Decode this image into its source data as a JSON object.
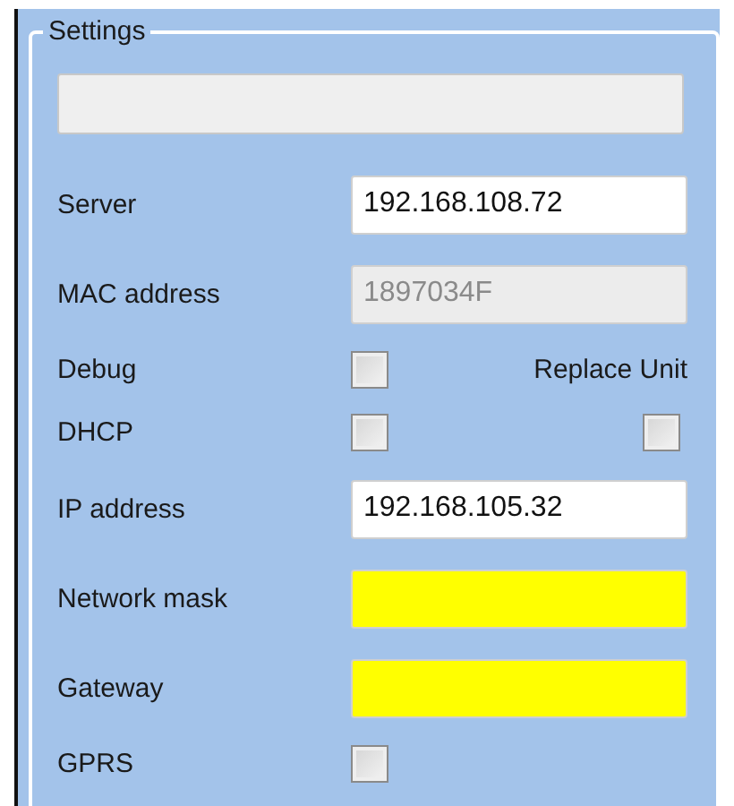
{
  "group": {
    "title": "Settings",
    "status_field": {
      "disabled": true
    }
  },
  "rows": [
    {
      "kind": "field",
      "label": "Server",
      "value": "192.168.108.72",
      "disabled": false,
      "highlighted": false
    },
    {
      "kind": "field",
      "label": "MAC address",
      "value": "1897034F",
      "disabled": true,
      "highlighted": false
    },
    {
      "kind": "checkbox",
      "label": "Debug",
      "checked": false,
      "side_label": "Replace Unit"
    },
    {
      "kind": "checkbox",
      "label": "DHCP",
      "checked": false,
      "side_checkbox": {
        "checked": false
      }
    },
    {
      "kind": "field",
      "label": "IP address",
      "value": "192.168.105.32",
      "disabled": false,
      "highlighted": false
    },
    {
      "kind": "field",
      "label": "Network mask",
      "disabled": false,
      "highlighted": true
    },
    {
      "kind": "field",
      "label": "Gateway",
      "disabled": false,
      "highlighted": true
    },
    {
      "kind": "checkbox",
      "label": "GPRS",
      "checked": false
    }
  ]
}
